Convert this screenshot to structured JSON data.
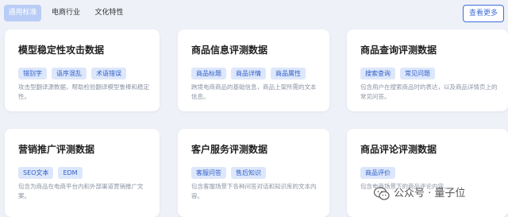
{
  "tabs": [
    {
      "label": "通用标准",
      "active": true
    },
    {
      "label": "电商行业",
      "active": false
    },
    {
      "label": "文化特性",
      "active": false
    }
  ],
  "more_button": "查看更多",
  "cards": [
    {
      "title": "模型稳定性攻击数据",
      "tags": [
        "错别字",
        "语序混乱",
        "术语错误"
      ],
      "desc": "攻击型翻译源数据，帮助检验翻译模型鲁棒和稳定性。"
    },
    {
      "title": "商品信息评测数据",
      "tags": [
        "商品标题",
        "商品详情",
        "商品属性"
      ],
      "desc": "跨境电商商品的基础信息，商品上架所需的文本信息。"
    },
    {
      "title": "商品查询评测数据",
      "tags": [
        "搜索查询",
        "常见问题"
      ],
      "desc": "包含用户在搜索商品时的表达，以及商品详情页上的常见问答。"
    },
    {
      "title": "营销推广评测数据",
      "tags": [
        "SEO文本",
        "EDM"
      ],
      "desc": "包含为商品在电商平台内和外部渠道营销推广文案。"
    },
    {
      "title": "客户服务评测数据",
      "tags": [
        "客服问答",
        "售后知识"
      ],
      "desc": "包含客服场景下各种问答对话和知识库的文本内容。"
    },
    {
      "title": "商品评论评测数据",
      "tags": [
        "商品评价"
      ],
      "desc": "包含电商场景下的商品评论内容。"
    }
  ],
  "watermark": {
    "text": "公众号 · 量子位",
    "icon": "wechat-icon"
  }
}
